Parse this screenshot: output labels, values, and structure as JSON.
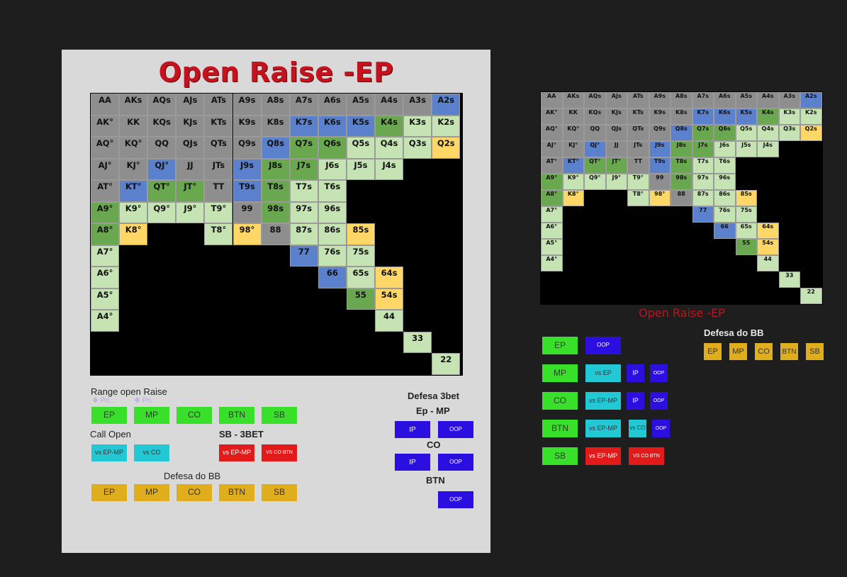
{
  "title": "Open Raise -EP",
  "colors": {
    "gray": "#8e8e8e",
    "blue": "#5b80cc",
    "green": "#6aa84f",
    "light": "#c6e3b3",
    "yellow": "#fed766",
    "black": "#000000",
    "btn_green": "#38e02a",
    "btn_cyan": "#22c9d5",
    "btn_red": "#e21a1a",
    "btn_blue": "#2a0fe0",
    "btn_gold": "#e0ad1c"
  },
  "range_grid": {
    "rows": [
      [
        [
          "AA",
          "g"
        ],
        [
          "AKs",
          "g"
        ],
        [
          "AQs",
          "g"
        ],
        [
          "AJs",
          "g"
        ],
        [
          "ATs",
          "g"
        ],
        [
          "A9s",
          "g"
        ],
        [
          "A8s",
          "g"
        ],
        [
          "A7s",
          "g"
        ],
        [
          "A6s",
          "g"
        ],
        [
          "A5s",
          "g"
        ],
        [
          "A4s",
          "g"
        ],
        [
          "A3s",
          "g"
        ],
        [
          "A2s",
          "b"
        ]
      ],
      [
        [
          "AK°",
          "g"
        ],
        [
          "KK",
          "g"
        ],
        [
          "KQs",
          "g"
        ],
        [
          "KJs",
          "g"
        ],
        [
          "KTs",
          "g"
        ],
        [
          "K9s",
          "g"
        ],
        [
          "K8s",
          "g"
        ],
        [
          "K7s",
          "b"
        ],
        [
          "K6s",
          "b"
        ],
        [
          "K5s",
          "b"
        ],
        [
          "K4s",
          "n"
        ],
        [
          "K3s",
          "l"
        ],
        [
          "K2s",
          "l"
        ]
      ],
      [
        [
          "AQ°",
          "g"
        ],
        [
          "KQ°",
          "g"
        ],
        [
          "QQ",
          "g"
        ],
        [
          "QJs",
          "g"
        ],
        [
          "QTs",
          "g"
        ],
        [
          "Q9s",
          "g"
        ],
        [
          "Q8s",
          "b"
        ],
        [
          "Q7s",
          "n"
        ],
        [
          "Q6s",
          "n"
        ],
        [
          "Q5s",
          "l"
        ],
        [
          "Q4s",
          "l"
        ],
        [
          "Q3s",
          "l"
        ],
        [
          "Q2s",
          "y"
        ]
      ],
      [
        [
          "AJ°",
          "g"
        ],
        [
          "KJ°",
          "g"
        ],
        [
          "QJ°",
          "b"
        ],
        [
          "JJ",
          "g"
        ],
        [
          "JTs",
          "g"
        ],
        [
          "J9s",
          "b"
        ],
        [
          "J8s",
          "n"
        ],
        [
          "J7s",
          "n"
        ],
        [
          "J6s",
          "l"
        ],
        [
          "J5s",
          "l"
        ],
        [
          "J4s",
          "l"
        ],
        [
          "",
          "k"
        ],
        [
          "",
          "k"
        ]
      ],
      [
        [
          "AT°",
          "g"
        ],
        [
          "KT°",
          "b"
        ],
        [
          "QT°",
          "n"
        ],
        [
          "JT°",
          "n"
        ],
        [
          "TT",
          "g"
        ],
        [
          "T9s",
          "b"
        ],
        [
          "T8s",
          "n"
        ],
        [
          "T7s",
          "l"
        ],
        [
          "T6s",
          "l"
        ],
        [
          "",
          "k"
        ],
        [
          "",
          "k"
        ],
        [
          "",
          "k"
        ],
        [
          "",
          "k"
        ]
      ],
      [
        [
          "A9°",
          "n"
        ],
        [
          "K9°",
          "l"
        ],
        [
          "Q9°",
          "l"
        ],
        [
          "J9°",
          "l"
        ],
        [
          "T9°",
          "l"
        ],
        [
          "99",
          "g"
        ],
        [
          "98s",
          "n"
        ],
        [
          "97s",
          "l"
        ],
        [
          "96s",
          "l"
        ],
        [
          "",
          "k"
        ],
        [
          "",
          "k"
        ],
        [
          "",
          "k"
        ],
        [
          "",
          "k"
        ]
      ],
      [
        [
          "A8°",
          "n"
        ],
        [
          "K8°",
          "y"
        ],
        [
          "",
          "k"
        ],
        [
          "",
          "k"
        ],
        [
          "T8°",
          "l"
        ],
        [
          "98°",
          "y"
        ],
        [
          "88",
          "g"
        ],
        [
          "87s",
          "l"
        ],
        [
          "86s",
          "l"
        ],
        [
          "85s",
          "y"
        ],
        [
          "",
          "k"
        ],
        [
          "",
          "k"
        ],
        [
          "",
          "k"
        ]
      ],
      [
        [
          "A7°",
          "l"
        ],
        [
          "",
          "k"
        ],
        [
          "",
          "k"
        ],
        [
          "",
          "k"
        ],
        [
          "",
          "k"
        ],
        [
          "",
          "k"
        ],
        [
          "",
          "k"
        ],
        [
          "77",
          "b"
        ],
        [
          "76s",
          "l"
        ],
        [
          "75s",
          "l"
        ],
        [
          "",
          "k"
        ],
        [
          "",
          "k"
        ],
        [
          "",
          "k"
        ]
      ],
      [
        [
          "A6°",
          "l"
        ],
        [
          "",
          "k"
        ],
        [
          "",
          "k"
        ],
        [
          "",
          "k"
        ],
        [
          "",
          "k"
        ],
        [
          "",
          "k"
        ],
        [
          "",
          "k"
        ],
        [
          "",
          "k"
        ],
        [
          "66",
          "b"
        ],
        [
          "65s",
          "l"
        ],
        [
          "64s",
          "y"
        ],
        [
          "",
          "k"
        ],
        [
          "",
          "k"
        ]
      ],
      [
        [
          "A5°",
          "l"
        ],
        [
          "",
          "k"
        ],
        [
          "",
          "k"
        ],
        [
          "",
          "k"
        ],
        [
          "",
          "k"
        ],
        [
          "",
          "k"
        ],
        [
          "",
          "k"
        ],
        [
          "",
          "k"
        ],
        [
          "",
          "k"
        ],
        [
          "55",
          "n"
        ],
        [
          "54s",
          "y"
        ],
        [
          "",
          "k"
        ],
        [
          "",
          "k"
        ]
      ],
      [
        [
          "A4°",
          "l"
        ],
        [
          "",
          "k"
        ],
        [
          "",
          "k"
        ],
        [
          "",
          "k"
        ],
        [
          "",
          "k"
        ],
        [
          "",
          "k"
        ],
        [
          "",
          "k"
        ],
        [
          "",
          "k"
        ],
        [
          "",
          "k"
        ],
        [
          "",
          "k"
        ],
        [
          "44",
          "l"
        ],
        [
          "",
          "k"
        ],
        [
          "",
          "k"
        ]
      ],
      [
        [
          "",
          "k"
        ],
        [
          "",
          "k"
        ],
        [
          "",
          "k"
        ],
        [
          "",
          "k"
        ],
        [
          "",
          "k"
        ],
        [
          "",
          "k"
        ],
        [
          "",
          "k"
        ],
        [
          "",
          "k"
        ],
        [
          "",
          "k"
        ],
        [
          "",
          "k"
        ],
        [
          "",
          "k"
        ],
        [
          "33",
          "l"
        ],
        [
          "",
          "k"
        ]
      ],
      [
        [
          "",
          "k"
        ],
        [
          "",
          "k"
        ],
        [
          "",
          "k"
        ],
        [
          "",
          "k"
        ],
        [
          "",
          "k"
        ],
        [
          "",
          "k"
        ],
        [
          "",
          "k"
        ],
        [
          "",
          "k"
        ],
        [
          "",
          "k"
        ],
        [
          "",
          "k"
        ],
        [
          "",
          "k"
        ],
        [
          "",
          "k"
        ],
        [
          "22",
          "l"
        ]
      ]
    ]
  },
  "left_nav": {
    "range_title": "Range open Raise",
    "priority_1": "❖ Pri...",
    "priority_2": "❖ Pri...",
    "positions": [
      "EP",
      "MP",
      "CO",
      "BTN",
      "SB"
    ],
    "call_open_title": "Call Open",
    "call_open": [
      "vs EP-MP",
      "vs CO"
    ],
    "sb_3bet_title": "SB - 3BET",
    "sb_3bet": [
      "vs EP-MP",
      "VS CO BTN"
    ],
    "defesa_bb_title": "Defesa do BB",
    "defesa_bb": [
      "EP",
      "MP",
      "CO",
      "BTN",
      "SB"
    ],
    "defesa_3bet_title": "Defesa 3bet",
    "ep_mp_title": "Ep - MP",
    "co_title": "CO",
    "btn_title": "BTN",
    "ip": "IP",
    "oop": "OOP"
  },
  "right_nav": {
    "defesa_bb_title": "Defesa do BB",
    "defesa_bb": [
      "EP",
      "MP",
      "CO",
      "BTN",
      "SB"
    ],
    "rows": {
      "ep": {
        "pos": "EP",
        "oop": "OOP"
      },
      "mp": {
        "pos": "MP",
        "vs": "vs EP",
        "ip": "IP",
        "oop": "OOP"
      },
      "co": {
        "pos": "CO",
        "vs": "vs EP-MP",
        "ip": "IP",
        "oop": "OOP"
      },
      "btn": {
        "pos": "BTN",
        "vs": "vs EP-MP",
        "vs_co": "vs CO",
        "oop": "OOP"
      },
      "sb": {
        "pos": "SB",
        "vs": "vs EP-MP",
        "vs_cobtn": "VS CO BTN"
      }
    }
  }
}
